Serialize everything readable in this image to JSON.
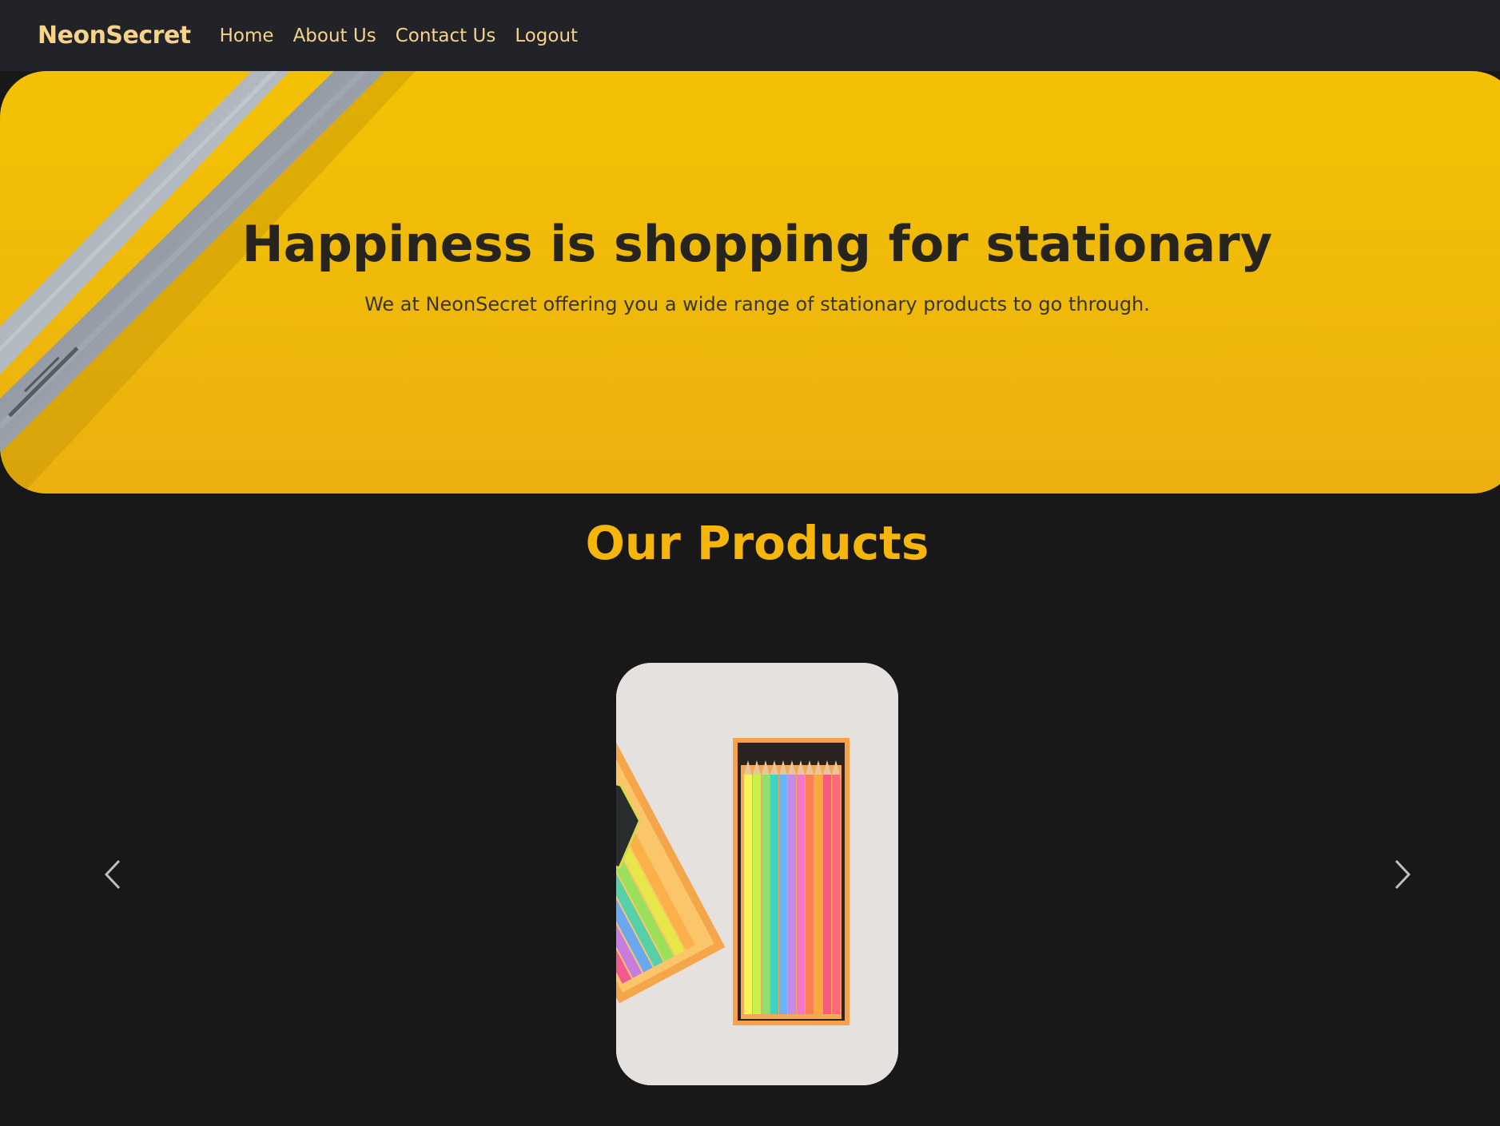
{
  "navbar": {
    "brand": "NeonSecret",
    "links": [
      "Home",
      "About Us",
      "Contact Us",
      "Logout"
    ]
  },
  "hero": {
    "title": "Happiness is shopping for stationary",
    "subtitle": "We at NeonSecret offering you a wide range of stationary products to go through."
  },
  "products": {
    "heading": "Our Products"
  },
  "colors": {
    "navbar_bg": "#212328",
    "page_bg": "#181819",
    "accent": "#f5b50a",
    "nav_text": "#f6d38a",
    "hero_yellow": "#f3c104"
  },
  "icons": {
    "prev": "chevron-left-icon",
    "next": "chevron-right-icon"
  }
}
